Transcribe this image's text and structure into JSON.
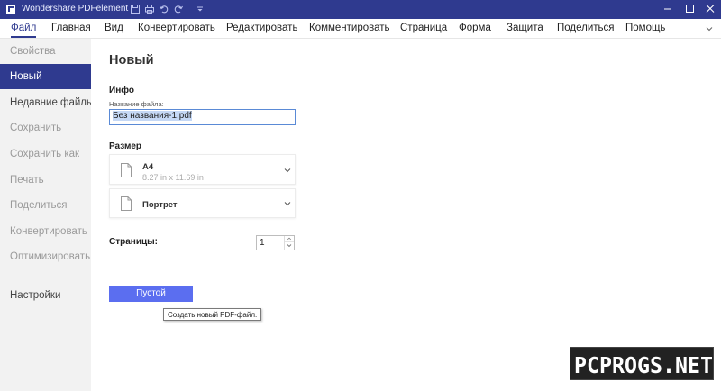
{
  "window": {
    "title": "Wondershare PDFelement",
    "title_bar_color": "#2f3a8f",
    "quick_access_icons": [
      "save-icon",
      "print-icon",
      "undo-icon",
      "redo-icon",
      "customize-icon"
    ],
    "controls": [
      "minimize-icon",
      "maximize-icon",
      "close-icon"
    ]
  },
  "menu": {
    "items": [
      "Файл",
      "Главная",
      "Вид",
      "Конвертировать",
      "Редактировать",
      "Комментировать",
      "Страница",
      "Форма",
      "Защита",
      "Поделиться",
      "Помощь"
    ],
    "active": "Файл"
  },
  "sidebar": {
    "items": [
      {
        "label": "Свойства",
        "state": "disabled"
      },
      {
        "label": "Новый",
        "state": "active"
      },
      {
        "label": "Недавние файлы",
        "state": "enabled"
      },
      {
        "label": "Сохранить",
        "state": "disabled"
      },
      {
        "label": "Сохранить как",
        "state": "disabled"
      },
      {
        "label": "Печать",
        "state": "disabled"
      },
      {
        "label": "Поделиться",
        "state": "disabled"
      },
      {
        "label": "Конвертировать",
        "state": "disabled"
      },
      {
        "label": "Оптимизировать",
        "state": "disabled"
      },
      {
        "label": "Настройки",
        "state": "enabled"
      }
    ]
  },
  "main": {
    "title": "Новый",
    "info_section": "Инфо",
    "filename_label": "Название файла:",
    "filename_value": "Без названия-1.pdf",
    "size_section": "Размер",
    "paper": {
      "name": "A4",
      "dimensions": "8.27 in x 11.69 in"
    },
    "orientation": "Портрет",
    "pages_label": "Страницы:",
    "pages_value": "1",
    "blank_button": "Пустой",
    "tooltip": "Создать новый PDF-файл."
  },
  "watermark": "PCPROGS.NET",
  "colors": {
    "accent": "#2f3a8f",
    "button": "#5b6ef0",
    "sidebar_bg": "#f2f2f2"
  }
}
